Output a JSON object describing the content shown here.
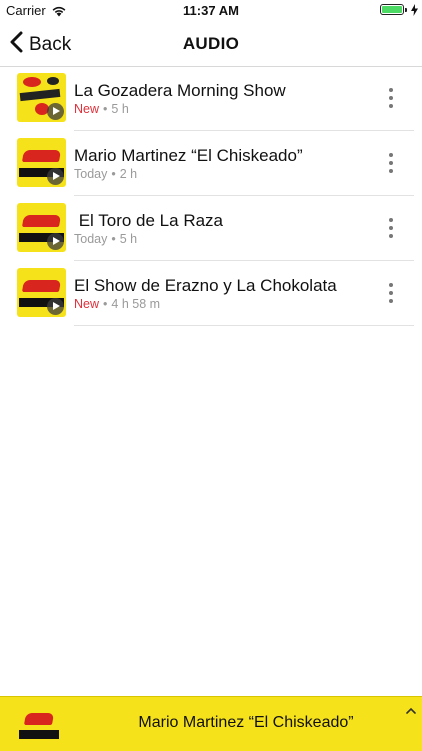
{
  "status": {
    "carrier": "Carrier",
    "time": "11:37 AM"
  },
  "nav": {
    "back_label": "Back",
    "title": "AUDIO"
  },
  "items": [
    {
      "title": "La Gozadera Morning Show",
      "badge": "New",
      "age": "5 h",
      "thumb": "la-gozadera-logo"
    },
    {
      "title": "Mario Martinez “El Chiskeado”",
      "badge": "Today",
      "age": "2 h",
      "thumb": "la-raza-logo"
    },
    {
      "title": " El Toro de La Raza",
      "badge": "Today",
      "age": "5 h",
      "thumb": "la-raza-logo"
    },
    {
      "title": "El Show de Erazno y La Chokolata",
      "badge": "New",
      "age": "4 h 58 m",
      "thumb": "la-raza-logo"
    }
  ],
  "player": {
    "title": "Mario Martinez “El Chiskeado”"
  },
  "colors": {
    "accent_yellow": "#f6e21a",
    "new_red": "#e0303a",
    "battery_green": "#4cd964"
  }
}
